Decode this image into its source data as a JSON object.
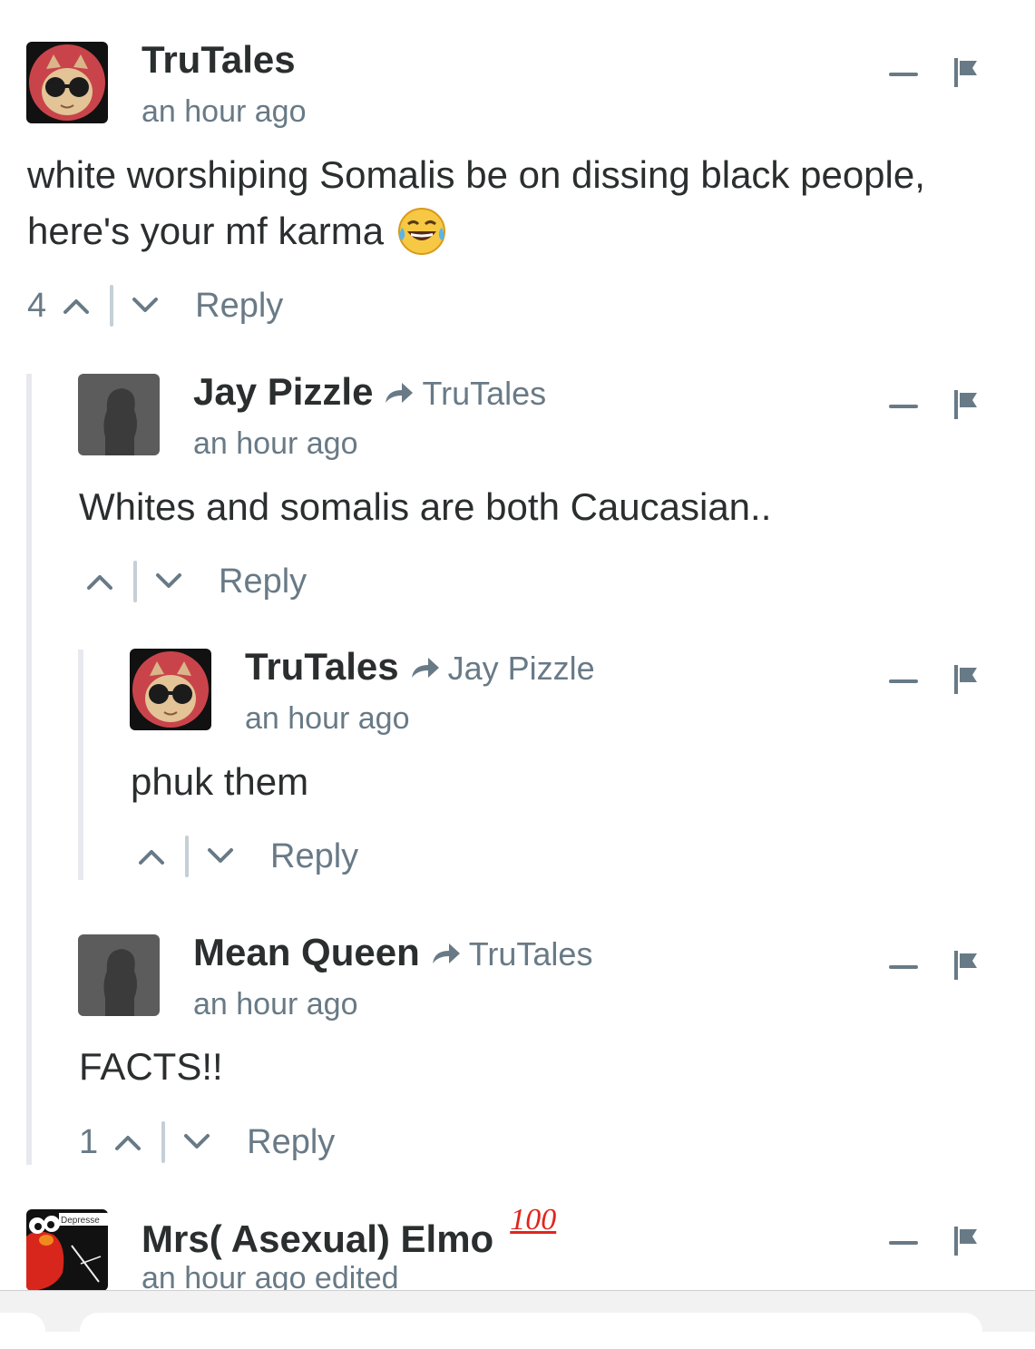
{
  "comments": [
    {
      "author": "TruTales",
      "time": "an hour ago",
      "body": "white worshiping Somalis be on dissing black people,",
      "body2": "here's your mf karma",
      "votes": "4",
      "reply_label": "Reply",
      "avatar": "cat-sunglasses-avatar"
    },
    {
      "author": "Jay Pizzle",
      "parent": "TruTales",
      "time": "an hour ago",
      "body": "Whites and somalis are both Caucasian..",
      "reply_label": "Reply",
      "avatar": "default-silhouette-avatar"
    },
    {
      "author": "TruTales",
      "parent": "Jay Pizzle",
      "time": "an hour ago",
      "body": "phuk them",
      "reply_label": "Reply",
      "avatar": "cat-sunglasses-avatar"
    },
    {
      "author": "Mean Queen",
      "parent": "TruTales",
      "time": "an hour ago",
      "body": "FACTS!!",
      "votes": "1",
      "reply_label": "Reply",
      "avatar": "default-silhouette-avatar"
    },
    {
      "author": "Mrs( Asexual) Elmo",
      "time": "an hour ago edited",
      "badge_text": "100",
      "avatar_text": "Depresse",
      "avatar": "elmo-avatar"
    }
  ],
  "colors": {
    "text": "#2a2e2e",
    "meta": "#687a86",
    "thread_bar": "#e7e9ee",
    "badge_red": "#e0261e"
  },
  "icons": [
    "minus-icon",
    "flag-icon",
    "upvote-icon",
    "downvote-icon",
    "reply-arrow-icon",
    "laughing-tears-emoji",
    "hundred-points-emoji"
  ]
}
